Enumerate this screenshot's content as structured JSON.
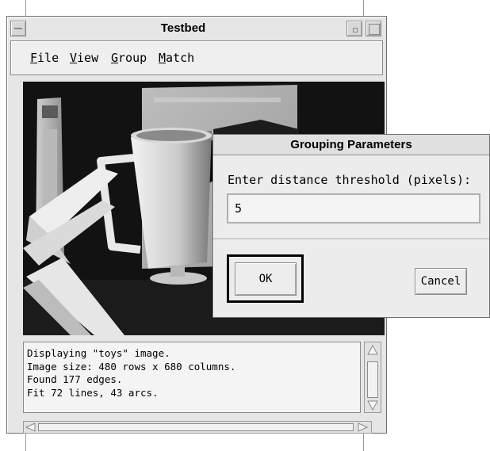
{
  "window": {
    "title": "Testbed",
    "menu": [
      {
        "accel": "F",
        "rest": "ile"
      },
      {
        "accel": "V",
        "rest": "iew"
      },
      {
        "accel": "G",
        "rest": "roup"
      },
      {
        "accel": "M",
        "rest": "atch"
      }
    ],
    "output_lines": [
      "Displaying \"toys\" image.",
      "Image size: 480 rows x 680 columns.",
      "Found 177 edges.",
      "Fit 72 lines, 43 arcs."
    ]
  },
  "dialog": {
    "title": "Grouping Parameters",
    "prompt": "Enter distance threshold (pixels):",
    "input_value": "5",
    "ok_label": "OK",
    "cancel_label": "Cancel"
  },
  "icons": [
    "window-menu-icon",
    "minimize-icon",
    "maximize-icon",
    "scroll-up-icon",
    "scroll-down-icon",
    "scroll-left-icon",
    "scroll-right-icon"
  ]
}
